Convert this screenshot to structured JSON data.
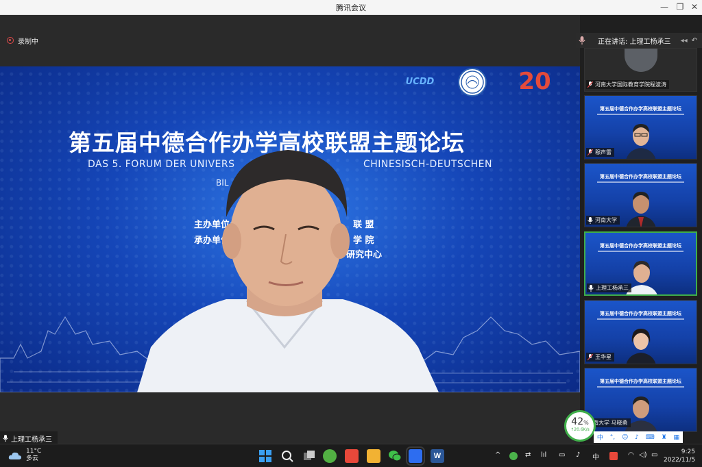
{
  "window": {
    "title": "腾讯会议",
    "min": "—",
    "restore": "❐",
    "close": "✕"
  },
  "recording": {
    "label": "录制中"
  },
  "main_video": {
    "banner_title": "第五届中德合作办学高校联盟主题论坛",
    "banner_sub_left": "DAS 5. FORUM DER UNIVERS",
    "banner_sub_right": "CHINESISCH-DEUTSCHEN",
    "banner_sub_line2": "BIL",
    "host_label": "主办单位:",
    "host_tail": "联 盟",
    "co_label": "承办单位:",
    "co_tail": "学 院",
    "line3_tail": "研究中心",
    "line4_start": "2",
    "logo_ucdd": "UCDD",
    "logo_20": "20"
  },
  "speaker": {
    "name": "上理工杨承三"
  },
  "speaking_now": {
    "label": "正在讲话: 上理工杨承三"
  },
  "tiles": [
    {
      "name": "河南大学国际教育学院程波涛"
    },
    {
      "name": "穆声雷"
    },
    {
      "name": "河南大学"
    },
    {
      "name": "上理工杨承三"
    },
    {
      "name": "王华星"
    },
    {
      "name": "河南大学 马晓勇"
    }
  ],
  "tile_banner": "第五届中德合作办学高校联盟主题论坛",
  "network": {
    "percent": "42",
    "unit": "%",
    "speed": "↑20.6K/s"
  },
  "ime": {
    "mode": "中"
  },
  "taskbar": {
    "weather_temp": "11°C",
    "weather_desc": "多云",
    "tray_lang": "中",
    "time": "9:25",
    "date": "2022/11/5"
  }
}
